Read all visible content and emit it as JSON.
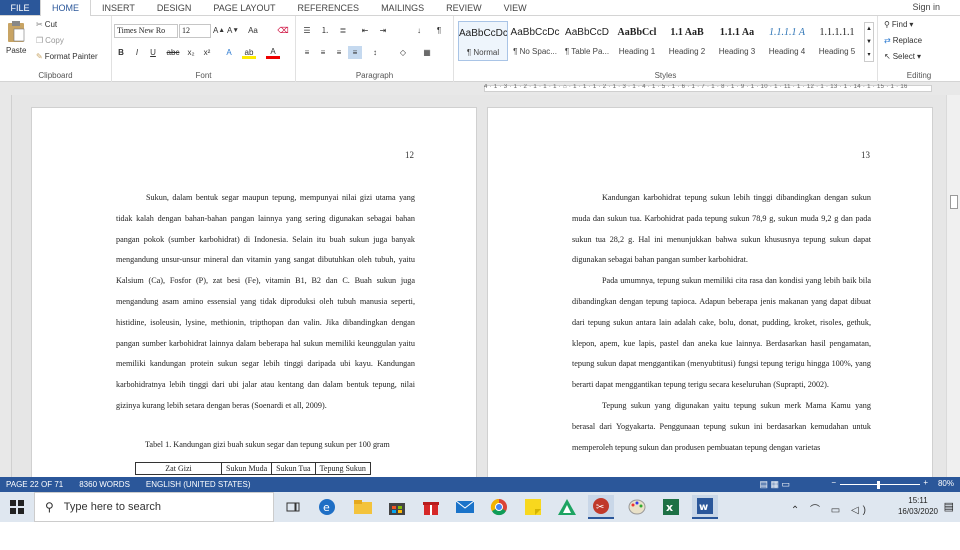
{
  "tabs": {
    "file": "FILE",
    "items": [
      "HOME",
      "INSERT",
      "DESIGN",
      "PAGE LAYOUT",
      "REFERENCES",
      "MAILINGS",
      "REVIEW",
      "VIEW"
    ],
    "signin": "Sign in"
  },
  "clipboard": {
    "paste": "Paste",
    "cut": "Cut",
    "copy": "Copy",
    "format_painter": "Format Painter",
    "label": "Clipboard"
  },
  "font": {
    "name": "Times New Ro",
    "size": "12",
    "label": "Font"
  },
  "paragraph": {
    "label": "Paragraph"
  },
  "styles": {
    "label": "Styles",
    "items": [
      {
        "preview": "AaBbCcDc",
        "name": "¶ Normal"
      },
      {
        "preview": "AaBbCcDc",
        "name": "¶ No Spac..."
      },
      {
        "preview": "AaBbCcD",
        "name": "¶ Table Pa..."
      },
      {
        "preview": "AaBbCcl",
        "name": "Heading 1"
      },
      {
        "preview": "1.1  AaB",
        "name": "Heading 2"
      },
      {
        "preview": "1.1.1  Aa",
        "name": "Heading 3"
      },
      {
        "preview": "1.1.1.1  A",
        "name": "Heading 4"
      },
      {
        "preview": "1.1.1.1.1",
        "name": "Heading 5"
      }
    ]
  },
  "editing": {
    "find": "Find",
    "replace": "Replace",
    "select": "Select",
    "label": "Editing"
  },
  "ruler": {
    "ticks": "4 · 1 · 3 · 1 · 2 · 1 · 1 · 1 · ⌂ · 1 · 1 · 1 · 2 · 1 · 3 · 1 · 4 · 1 · 5 · 1 · 6 · 1 · 7 · 1 · 8 · 1 · 9 · 1 · 10 · 1 · 11 · 1 · 12 · 1 · 13 · 1 · 14 · 1 · 15 · 1 · 16"
  },
  "page_left": {
    "number": "12",
    "text": "Sukun, dalam bentuk segar maupun tepung, mempunyai nilai gizi utama yang tidak kalah dengan bahan-bahan pangan lainnya yang sering digunakan sebagai bahan pangan pokok (sumber karbohidrat) di Indonesia. Selain itu buah sukun juga banyak mengandung unsur-unsur mineral dan vitamin yang sangat dibutuhkan oleh tubuh, yaitu Kalsium (Ca), Fosfor (P), zat besi (Fe), vitamin B1, B2 dan C. Buah sukun juga mengandung asam amino essensial yang tidak diproduksi oleh tubuh manusia seperti, histidine, isoleusin, lysine, methionin, tripthopan dan valin. Jika dibandingkan dengan pangan sumber karbohidrat lainnya dalam beberapa hal sukun memiliki keunggulan yaitu memiliki kandungan protein sukun segar lebih tinggi daripada ubi kayu. Kandungan karbohidratnya lebih tinggi dari ubi jalar atau kentang dan dalam bentuk tepung, nilai gizinya kurang lebih setara dengan beras (Soenardi et all, 2009).",
    "caption": "Tabel 1. Kandungan gizi buah sukun segar dan tepung sukun per 100 gram",
    "table_headers": [
      "Zat Gizi",
      "Sukun Muda",
      "Sukun Tua",
      "Tepung Sukun"
    ]
  },
  "page_right": {
    "number": "13",
    "paragraphs": [
      "Kandungan karbohidrat tepung sukun lebih tinggi dibandingkan dengan sukun muda dan sukun tua. Karbohidrat pada tepung sukun 78,9 g, sukun muda 9,2 g dan pada sukun tua 28,2 g. Hal ini menunjukkan bahwa sukun khususnya tepung sukun dapat digunakan sebagai bahan pangan sumber karbohidrat.",
      "Pada umumnya, tepung sukun memiliki cita rasa dan kondisi yang lebih baik bila dibandingkan dengan tepung tapioca. Adapun beberapa jenis makanan yang dapat dibuat dari tepung sukun antara lain adalah cake, bolu, donat, pudding, kroket, risoles, gethuk, klepon, apem, kue lapis, pastel dan aneka kue lainnya. Berdasarkan hasil pengamatan, tepung sukun dapat menggantikan (menyubtitusi) fungsi tepung terigu hingga 100%, yang berarti dapat menggantikan tepung terigu secara keseluruhan (Suprapti, 2002).",
      "Tepung sukun yang digunakan yaitu tepung sukun merk Mama Kamu yang berasal dari Yogyakarta. Penggunaan tepung sukun ini berdasarkan kemudahan untuk memperoleh tepung sukun dan produsen pembuatan tepung dengan varietas"
    ]
  },
  "status": {
    "page": "PAGE 22 OF 71",
    "words": "8360 WORDS",
    "language": "ENGLISH (UNITED STATES)",
    "zoom": "80%"
  },
  "taskbar": {
    "search_placeholder": "Type here to search",
    "time": "15:11",
    "date": "16/03/2020"
  }
}
